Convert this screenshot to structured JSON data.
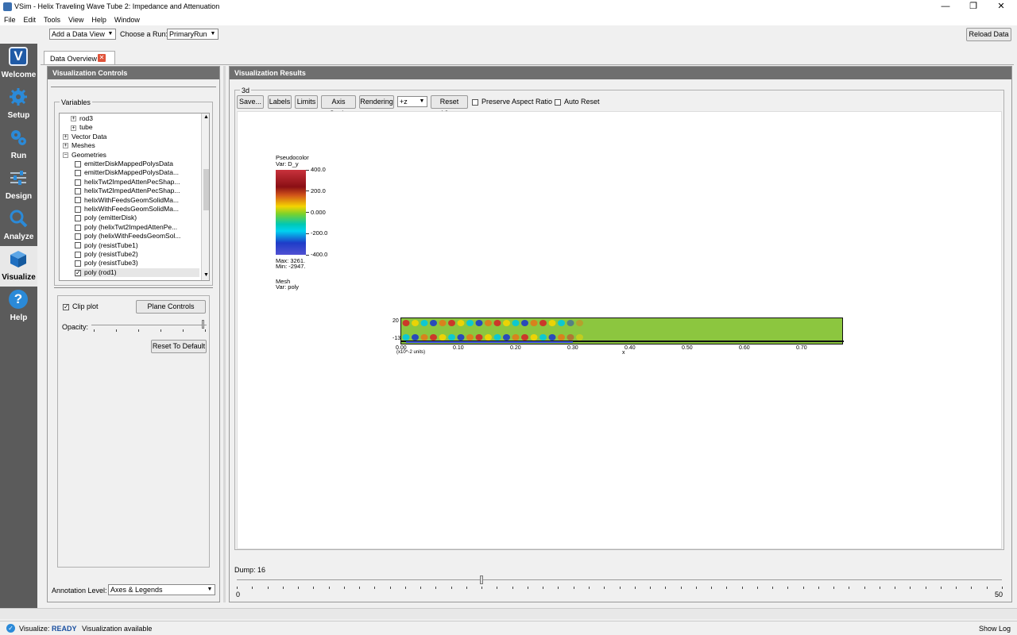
{
  "window": {
    "title": "VSim - Helix Traveling Wave Tube 2: Impedance and Attenuation",
    "minimize": "—",
    "maximize": "❐",
    "close": "✕"
  },
  "menu": [
    "File",
    "Edit",
    "Tools",
    "View",
    "Help",
    "Window"
  ],
  "toolbar": {
    "add_data_view": "Add a Data View",
    "choose_run_label": "Choose a Run:",
    "run_value": "PrimaryRun",
    "reload": "Reload Data"
  },
  "nav": [
    {
      "label": "Welcome",
      "icon": "vsim-logo-icon"
    },
    {
      "label": "Setup",
      "icon": "gear-icon"
    },
    {
      "label": "Run",
      "icon": "gears-icon"
    },
    {
      "label": "Design",
      "icon": "sliders-icon"
    },
    {
      "label": "Analyze",
      "icon": "magnifier-icon"
    },
    {
      "label": "Visualize",
      "icon": "cube-icon"
    },
    {
      "label": "Help",
      "icon": "question-icon"
    }
  ],
  "tab": {
    "label": "Data Overview"
  },
  "controls": {
    "header": "Visualization Controls",
    "variables_label": "Variables",
    "tree": [
      {
        "indent": 2,
        "type": "exp",
        "label": "rod3"
      },
      {
        "indent": 2,
        "type": "exp",
        "label": "tube"
      },
      {
        "indent": 0,
        "type": "exp",
        "label": "Vector Data"
      },
      {
        "indent": 0,
        "type": "exp",
        "label": "Meshes"
      },
      {
        "indent": 0,
        "type": "col",
        "label": "Geometries"
      },
      {
        "indent": 3,
        "type": "chk",
        "checked": false,
        "label": "emitterDiskMappedPolysData"
      },
      {
        "indent": 3,
        "type": "chk",
        "checked": false,
        "label": "emitterDiskMappedPolysData..."
      },
      {
        "indent": 3,
        "type": "chk",
        "checked": false,
        "label": "helixTwt2ImpedAttenPecShap..."
      },
      {
        "indent": 3,
        "type": "chk",
        "checked": false,
        "label": "helixTwt2ImpedAttenPecShap..."
      },
      {
        "indent": 3,
        "type": "chk",
        "checked": false,
        "label": "helixWithFeedsGeomSolidMa..."
      },
      {
        "indent": 3,
        "type": "chk",
        "checked": false,
        "label": "helixWithFeedsGeomSolidMa..."
      },
      {
        "indent": 3,
        "type": "chk",
        "checked": false,
        "label": "poly (emitterDisk)"
      },
      {
        "indent": 3,
        "type": "chk",
        "checked": false,
        "label": "poly (helixTwt2ImpedAttenPe..."
      },
      {
        "indent": 3,
        "type": "chk",
        "checked": false,
        "label": "poly (helixWithFeedsGeomSol..."
      },
      {
        "indent": 3,
        "type": "chk",
        "checked": false,
        "label": "poly (resistTube1)"
      },
      {
        "indent": 3,
        "type": "chk",
        "checked": false,
        "label": "poly (resistTube2)"
      },
      {
        "indent": 3,
        "type": "chk",
        "checked": false,
        "label": "poly (resistTube3)"
      },
      {
        "indent": 3,
        "type": "chk",
        "checked": true,
        "label": "poly (rod1)"
      }
    ],
    "clip_plot": "Clip plot",
    "plane_controls": "Plane Controls",
    "opacity": "Opacity:",
    "opacity_level": 0.97,
    "reset_default": "Reset To Default",
    "annotation_label": "Annotation Level:",
    "annotation_value": "Axes & Legends"
  },
  "results": {
    "header": "Visualization Results",
    "group": "3d",
    "buttons": [
      "Save...",
      "Labels",
      "Limits",
      "Axis Scale",
      "Rendering"
    ],
    "view_dir": "+z",
    "reset_view": "Reset View",
    "preserve_aspect": "Preserve Aspect Ratio",
    "auto_reset": "Auto Reset",
    "legend": {
      "title": "Pseudocolor",
      "var": "Var: D_y",
      "ticks": [
        "400.0",
        "200.0",
        "0.000",
        "-200.0",
        "-400.0"
      ],
      "max": "Max:  3261.",
      "min": "Min: -2947.",
      "mesh": "Mesh",
      "mesh_var": "Var: poly"
    },
    "xticks": [
      "0.00",
      "0.10",
      "0.20",
      "0.30",
      "0.40",
      "0.50",
      "0.60",
      "0.70"
    ],
    "x_axis_label": "x",
    "y_ticks": [
      "20",
      "",
      "-13"
    ],
    "unit_note": "(x10^-2 units)",
    "dump_label": "Dump: 16",
    "dump_min": "0",
    "dump_max": "50",
    "dump_value": 16
  },
  "status": {
    "label": "Visualize:",
    "state": "READY",
    "message": "Visualization available",
    "show_log": "Show Log"
  },
  "colors": {
    "sidebar": "#5b5b5b",
    "header": "#6f6f6f",
    "field_green": "#8cc63f",
    "ready": "#1a4fa0"
  }
}
